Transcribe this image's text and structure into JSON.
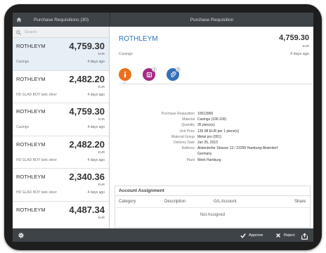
{
  "app": {
    "master_title": "Purchase Requisitions (30)",
    "detail_title": "Purchase Requisition"
  },
  "search": {
    "placeholder": "Search"
  },
  "list": [
    {
      "name": "ROTHLEYM",
      "amount": "4,759.30",
      "currency": "EUR",
      "sub": "Casings",
      "age": "4 days ago",
      "selected": true
    },
    {
      "name": "ROTHLEYM",
      "amount": "2,482.20",
      "currency": "EUR",
      "sub": "HD GLAD BOY tank silver",
      "age": "4 days ago"
    },
    {
      "name": "ROTHLEYM",
      "amount": "4,759.30",
      "currency": "EUR",
      "sub": "Casings",
      "age": "4 days ago"
    },
    {
      "name": "ROTHLEYM",
      "amount": "2,482.20",
      "currency": "EUR",
      "sub": "HD GLAD BOY tank silver",
      "age": "4 days ago"
    },
    {
      "name": "ROTHLEYM",
      "amount": "2,340.36",
      "currency": "EUR",
      "sub": "HD GLAD BOY tank silver",
      "age": "4 days ago"
    },
    {
      "name": "ROTHLEYM",
      "amount": "4,487.34",
      "currency": "EUR",
      "sub": "",
      "age": ""
    }
  ],
  "detail": {
    "name": "ROTHLEYM",
    "amount": "4,759.30",
    "currency": "EUR",
    "sub": "Casings",
    "age": "4 days ago",
    "icons": [
      {
        "name": "info-icon",
        "color": "#e8711f",
        "badge": ""
      },
      {
        "name": "notes-icon",
        "color": "#a32b86",
        "badge": "1"
      },
      {
        "name": "attachment-icon",
        "color": "#3470b8",
        "badge": "2"
      }
    ],
    "facts": [
      {
        "label": "Purchase Requisition",
        "value": "10013966"
      },
      {
        "label": "Material",
        "value": "Casings (100-100)"
      },
      {
        "label": "Quantity",
        "value": "35 piece(s)"
      },
      {
        "label": "Unit Price",
        "value": "135.98 EUR per 1 piece(s)"
      },
      {
        "label": "Material Group",
        "value": "Metal pro (001)"
      },
      {
        "label": "Delivery Date",
        "value": "Jun 25, 2013"
      },
      {
        "label": "Address",
        "value": "Alsterdorfer Strasse 13 / 22299 Hamburg-Alsterdorf"
      },
      {
        "label": "",
        "value": "Germany"
      },
      {
        "label": "Plant",
        "value": "Werk Hamburg"
      }
    ]
  },
  "account": {
    "title": "Account Assignment",
    "columns": [
      "Category",
      "Description",
      "G/L Account",
      "Share"
    ],
    "empty": "Not Assigned"
  },
  "footer": {
    "approve": "Approve",
    "reject": "Reject"
  }
}
